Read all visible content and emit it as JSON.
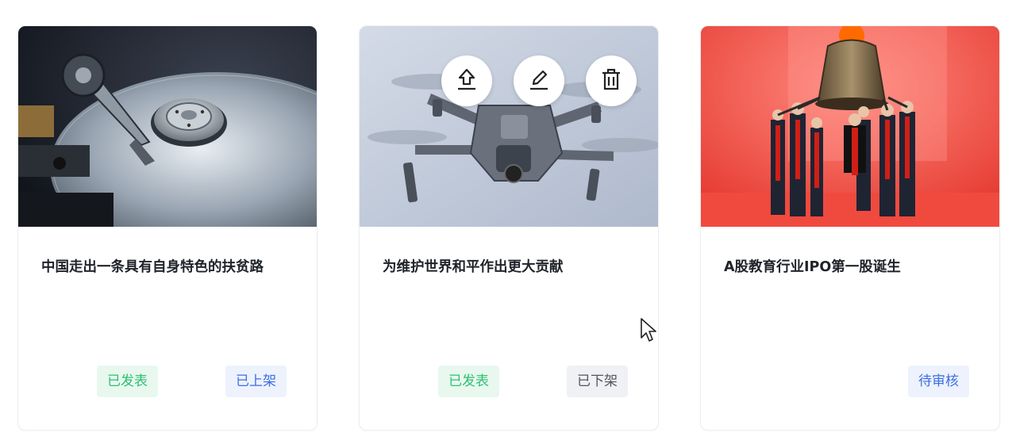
{
  "cards": [
    {
      "title": "中国走出一条具有自身特色的扶贫路",
      "image_alt": "hard-disk-drive-photo",
      "tags": [
        "已发表",
        "已上架"
      ]
    },
    {
      "title": "为维护世界和平作出更大贡献",
      "image_alt": "drone-photo",
      "tags": [
        "已发表",
        "已下架"
      ],
      "overlay_actions": [
        "upload-icon",
        "edit-icon",
        "delete-icon"
      ]
    },
    {
      "title": "A股教育行业IPO第一股诞生",
      "image_alt": "bell-ringing-ceremony-photo",
      "tags": [
        "待审核"
      ]
    }
  ],
  "colors": {
    "tag_published_bg": "#e8f8ef",
    "tag_published_text": "#2fbf71",
    "tag_status_bg": "#edf2fd",
    "tag_status_text": "#3d6fe0",
    "tag_offline_bg": "#f0f1f4",
    "tag_offline_text": "#50555e"
  }
}
